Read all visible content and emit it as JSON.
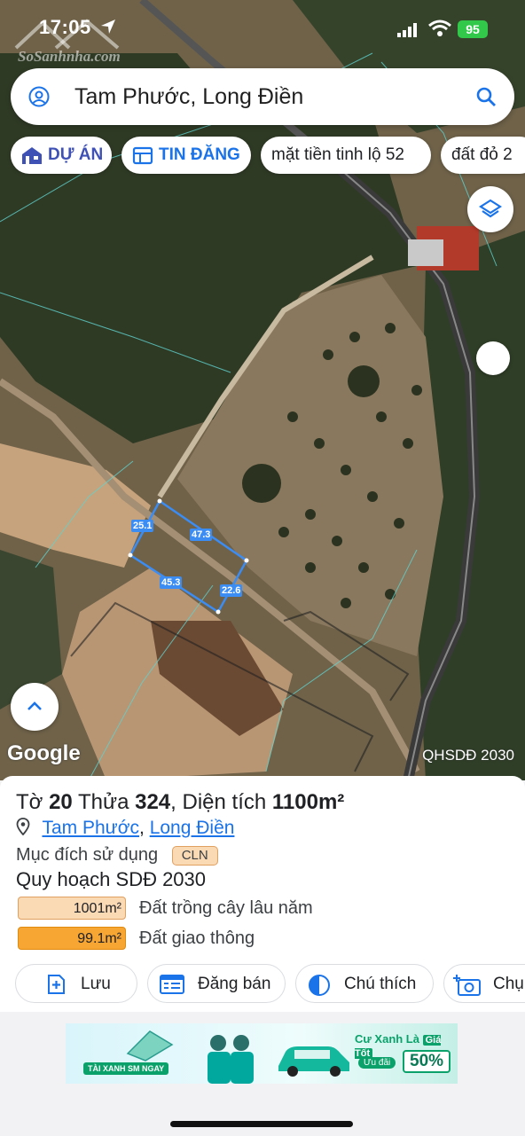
{
  "status": {
    "time": "17:05",
    "battery": "95"
  },
  "watermark": "SoSanhnha.com",
  "search": {
    "text": "Tam Phước, Long Điền"
  },
  "chips": [
    {
      "label": "DỰ ÁN"
    },
    {
      "label": "TIN ĐĂNG"
    },
    {
      "label": "mặt tiền tinh lộ 52"
    },
    {
      "label": "đất đỏ 2"
    }
  ],
  "map": {
    "logo": "Google",
    "overlay_label": "QHSDĐ 2030",
    "segments": [
      "25.1",
      "47.3",
      "45.3",
      "22.6"
    ]
  },
  "parcel": {
    "title_pre": "Tờ",
    "sheet": "20",
    "title_mid": "Thửa",
    "plot": "324",
    "title_area": ", Diện tích",
    "area": "1100m²",
    "ward": "Tam Phước",
    "comma": ",",
    "district": "Long Điền",
    "purpose_label": "Mục đích sử dụng",
    "purpose_code": "CLN",
    "plan_title": "Quy hoạch SDĐ 2030",
    "zones": [
      {
        "value": "1001m²",
        "label": "Đất trồng cây lâu năm",
        "color": "#fad9b5"
      },
      {
        "value": "99.1m²",
        "label": "Đất giao thông",
        "color": "#f7a533"
      }
    ]
  },
  "actions": [
    {
      "label": "Lưu"
    },
    {
      "label": "Đăng bán"
    },
    {
      "label": "Chú thích"
    },
    {
      "label": "Chụ"
    }
  ],
  "ad": {
    "tag": "TÀI XANH SM NGAY",
    "headline": "Cư Xanh Là",
    "badge": "Giá Tốt",
    "sub": "Ưu đãi",
    "discount": "50%"
  }
}
